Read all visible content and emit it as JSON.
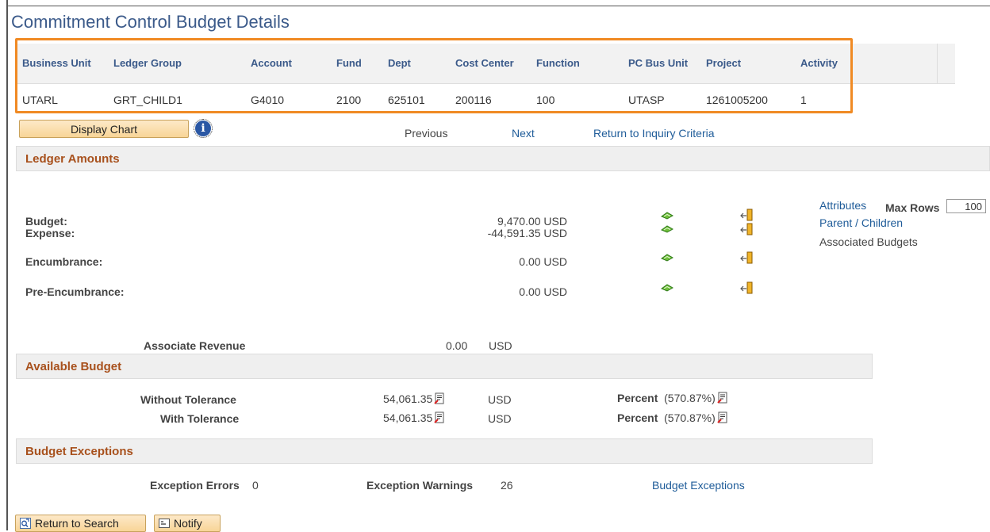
{
  "page": {
    "title": "Commitment Control Budget Details"
  },
  "keys": {
    "headers": [
      "Business Unit",
      "Ledger Group",
      "Account",
      "Fund",
      "Dept",
      "Cost Center",
      "Function",
      "PC Bus Unit",
      "Project",
      "Activity"
    ],
    "values": [
      "UTARL",
      "GRT_CHILD1",
      "G4010",
      "2100",
      "625101",
      "200116",
      "100",
      "UTASP",
      "1261005200",
      "1"
    ]
  },
  "toolbar": {
    "display_chart": "Display Chart",
    "info_icon": "info-icon",
    "info_glyph": "i",
    "previous": "Previous",
    "next": "Next",
    "return_inquiry": "Return to Inquiry Criteria"
  },
  "ledger": {
    "section_title": "Ledger Amounts",
    "rows": [
      {
        "label": "Budget:",
        "amount": "9,470.00 USD"
      },
      {
        "label": "Expense:",
        "amount": "-44,591.35 USD"
      },
      {
        "label": "Encumbrance:",
        "amount": "0.00 USD"
      },
      {
        "label": "Pre-Encumbrance:",
        "amount": "0.00 USD"
      }
    ],
    "max_rows_label": "Max Rows",
    "max_rows_value": "100",
    "links": {
      "attributes": "Attributes",
      "parent_children": "Parent / Children",
      "associated_budgets": "Associated Budgets"
    },
    "associate_revenue": {
      "label": "Associate Revenue",
      "amount": "0.00",
      "currency": "USD"
    }
  },
  "available": {
    "section_title": "Available Budget",
    "rows": [
      {
        "label": "Without Tolerance",
        "amount": "54,061.35",
        "currency": "USD",
        "percent_label": "Percent",
        "percent": "(570.87%)"
      },
      {
        "label": "With Tolerance",
        "amount": "54,061.35",
        "currency": "USD",
        "percent_label": "Percent",
        "percent": "(570.87%)"
      }
    ]
  },
  "exceptions": {
    "section_title": "Budget Exceptions",
    "errors_label": "Exception Errors",
    "errors_value": "0",
    "warnings_label": "Exception Warnings",
    "warnings_value": "26",
    "link": "Budget Exceptions"
  },
  "footer": {
    "return_to_search": "Return to Search",
    "notify": "Notify"
  },
  "colors": {
    "accent_orange": "#f08a24",
    "section_title": "#a8511d",
    "link": "#1f5c99",
    "header_text": "#3b5a8a"
  }
}
